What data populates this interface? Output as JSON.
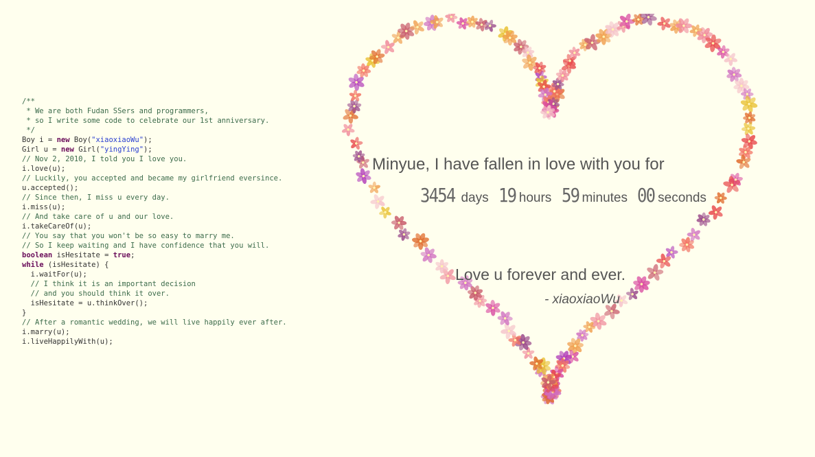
{
  "code": {
    "lines": [
      [
        [
          "cm",
          "/**"
        ]
      ],
      [
        [
          "cm",
          " * We are both Fudan SSers and programmers,"
        ]
      ],
      [
        [
          "cm",
          " * so I write some code to celebrate our 1st anniversary."
        ]
      ],
      [
        [
          "cm",
          " */"
        ]
      ],
      [
        [
          "tx",
          "Boy i = "
        ],
        [
          "kw",
          "new"
        ],
        [
          "tx",
          " Boy("
        ],
        [
          "st",
          "\"xiaoxiaoWu\""
        ],
        [
          "tx",
          ");"
        ]
      ],
      [
        [
          "tx",
          "Girl u = "
        ],
        [
          "kw",
          "new"
        ],
        [
          "tx",
          " Girl("
        ],
        [
          "st",
          "\"yingYing\""
        ],
        [
          "tx",
          ");"
        ]
      ],
      [
        [
          "cm",
          "// Nov 2, 2010, I told you I love you."
        ]
      ],
      [
        [
          "tx",
          "i.love(u);"
        ]
      ],
      [
        [
          "cm",
          "// Luckily, you accepted and became my girlfriend eversince."
        ]
      ],
      [
        [
          "tx",
          "u.accepted();"
        ]
      ],
      [
        [
          "cm",
          "// Since then, I miss u every day."
        ]
      ],
      [
        [
          "tx",
          "i.miss(u);"
        ]
      ],
      [
        [
          "cm",
          "// And take care of u and our love."
        ]
      ],
      [
        [
          "tx",
          "i.takeCareOf(u);"
        ]
      ],
      [
        [
          "cm",
          "// You say that you won't be so easy to marry me."
        ]
      ],
      [
        [
          "cm",
          "// So I keep waiting and I have confidence that you will."
        ]
      ],
      [
        [
          "kw",
          "boolean"
        ],
        [
          "tx",
          " isHesitate = "
        ],
        [
          "kw",
          "true"
        ],
        [
          "tx",
          ";"
        ]
      ],
      [
        [
          "kw",
          "while"
        ],
        [
          "tx",
          " (isHesitate) {"
        ]
      ],
      [
        [
          "tx",
          "  i.waitFor(u);"
        ]
      ],
      [
        [
          "cm",
          "  // I think it is an important decision"
        ]
      ],
      [
        [
          "cm",
          "  // and you should think it over."
        ]
      ],
      [
        [
          "tx",
          "  isHesitate = u.thinkOver();"
        ]
      ],
      [
        [
          "tx",
          "}"
        ]
      ],
      [
        [
          "cm",
          "// After a romantic wedding, we will live happily ever after."
        ]
      ],
      [
        [
          "tx",
          "i.marry(u);"
        ]
      ],
      [
        [
          "tx",
          "i.liveHappilyWith(u);"
        ]
      ]
    ]
  },
  "message": {
    "line1": "Minyue, I have fallen in love with you for",
    "days_value": "3454",
    "days_unit": "days",
    "hours_value": "19",
    "hours_unit": "hours",
    "minutes_value": "59",
    "minutes_unit": "minutes",
    "seconds_value": "00",
    "seconds_unit": "seconds",
    "line2": "Love u forever and ever.",
    "signature": "- xiaoxiaoWu"
  },
  "heart": {
    "flower_colors": [
      "#e8484a",
      "#f08a9a",
      "#d94aa0",
      "#b03ab8",
      "#f0a050",
      "#e06a2a",
      "#c85a6a",
      "#f5c0c8",
      "#9a4a8a",
      "#e8c030",
      "#f27060",
      "#d070c0"
    ]
  }
}
